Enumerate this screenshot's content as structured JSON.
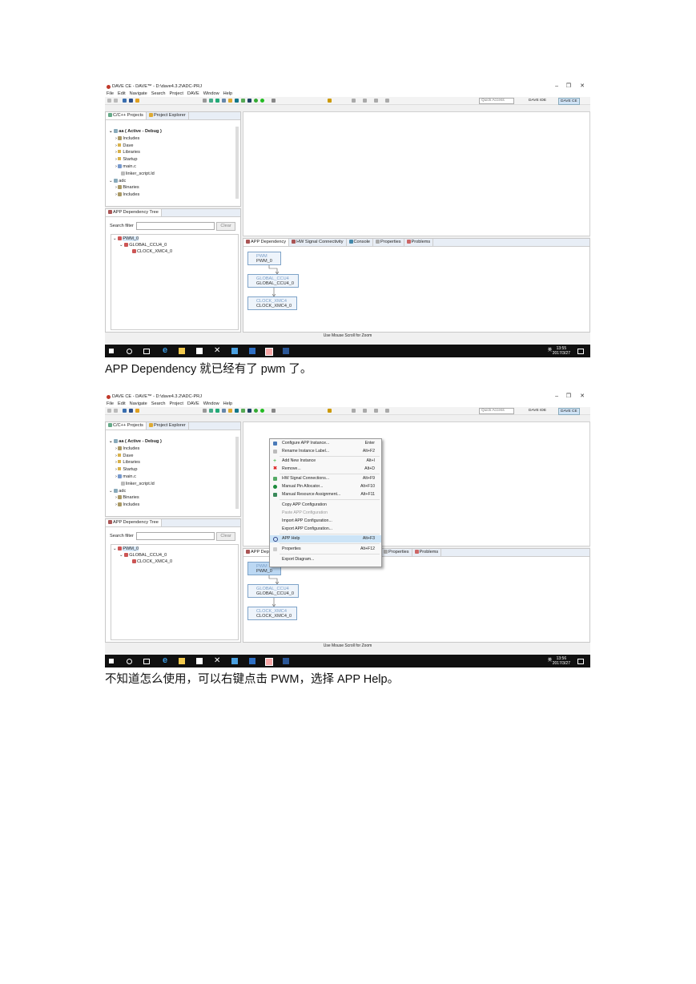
{
  "screens": [
    {
      "window_title": "DAVE CE - DAVE™ - D:\\dave4.3.2\\ADC-PRJ",
      "window_controls": [
        "–",
        "❐",
        "✕"
      ],
      "menus": [
        "File",
        "Edit",
        "Navigate",
        "Search",
        "Project",
        "DAVE",
        "Window",
        "Help"
      ],
      "quick_access": "Quick Access",
      "perspectives": [
        "DAVE IDE",
        "DAVE CE"
      ],
      "explorer_tabs": [
        "C/C++ Projects",
        "Project Explorer"
      ],
      "project_tree": [
        "aa ( Active - Debug )",
        "Includes",
        "Dave",
        "Libraries",
        "Startup",
        "main.c",
        "linker_script.ld",
        "adc",
        "Binaries",
        "Includes"
      ],
      "dep_tree_title": "APP Dependency Tree",
      "search_filter_label": "Search filter",
      "clear_button": "Clear",
      "dep_tree_items": [
        "PWM_0",
        "GLOBAL_CCU4_0",
        "CLOCK_XMC4_0"
      ],
      "bottom_tabs": [
        "APP Dependency",
        "HW Signal Connectivity",
        "Console",
        "Properties",
        "Problems"
      ],
      "diagram_nodes": [
        {
          "app": "PWM",
          "instance": "PWM_0"
        },
        {
          "app": "GLOBAL_CCU4",
          "instance": "GLOBAL_CCU4_0"
        },
        {
          "app": "CLOCK_XMC4",
          "instance": "CLOCK_XMC4_0"
        }
      ],
      "status_text": "Use Mouse Scroll for Zoom",
      "clock_time": "13:55",
      "clock_date": "2017/3/27",
      "ime": "英"
    },
    {
      "window_title": "DAVE CE - DAVE™ - D:\\dave4.3.2\\ADC-PRJ",
      "window_controls": [
        "–",
        "❐",
        "✕"
      ],
      "menus": [
        "File",
        "Edit",
        "Navigate",
        "Search",
        "Project",
        "DAVE",
        "Window",
        "Help"
      ],
      "quick_access": "Quick Access",
      "perspectives": [
        "DAVE IDE",
        "DAVE CE"
      ],
      "explorer_tabs": [
        "C/C++ Projects",
        "Project Explorer"
      ],
      "project_tree": [
        "aa ( Active - Debug )",
        "Includes",
        "Dave",
        "Libraries",
        "Startup",
        "main.c",
        "linker_script.ld",
        "adc",
        "Binaries",
        "Includes"
      ],
      "dep_tree_title": "APP Dependency Tree",
      "search_filter_label": "Search filter",
      "clear_button": "Clear",
      "dep_tree_items": [
        "PWM_0",
        "GLOBAL_CCU4_0",
        "CLOCK_XMC4_0"
      ],
      "bottom_tabs": [
        "APP Depe",
        "Properties",
        "Problems"
      ],
      "diagram_nodes": [
        {
          "app": "PWM",
          "instance": "PWM_0"
        },
        {
          "app": "GLOBAL_CCU4",
          "instance": "GLOBAL_CCU4_0"
        },
        {
          "app": "CLOCK_XMC4",
          "instance": "CLOCK_XMC4_0"
        }
      ],
      "status_text": "Use Mouse Scroll for Zoom",
      "clock_time": "13:56",
      "clock_date": "2017/3/27",
      "ime": "英",
      "context_menu": [
        {
          "label": "Configure APP Instance...",
          "key": "Enter"
        },
        {
          "label": "Rename Instance Label...",
          "key": "Alt+F2"
        },
        {
          "label": "Add New Instance",
          "key": "Alt+I"
        },
        {
          "label": "Remove...",
          "key": "Alt+D"
        },
        {
          "label": "HW Signal Connections...",
          "key": "Alt+F9"
        },
        {
          "label": "Manual Pin Allocator...",
          "key": "Alt+F10"
        },
        {
          "label": "Manual Resource Assignment...",
          "key": "Alt+F11"
        },
        {
          "label": "Copy APP Configuration",
          "key": ""
        },
        {
          "label": "Paste APP Configuration",
          "key": ""
        },
        {
          "label": "Import APP Configuration...",
          "key": ""
        },
        {
          "label": "Export APP Configuration...",
          "key": ""
        },
        {
          "label": "APP Help",
          "key": "Alt+F3"
        },
        {
          "label": "Properties",
          "key": "Alt+F12"
        },
        {
          "label": "Export Diagram...",
          "key": ""
        }
      ]
    }
  ],
  "captions": [
    "APP Dependency 就已经有了 pwm 了。",
    "不知道怎么使用，可以右键点击 PWM，选择 APP Help。"
  ]
}
